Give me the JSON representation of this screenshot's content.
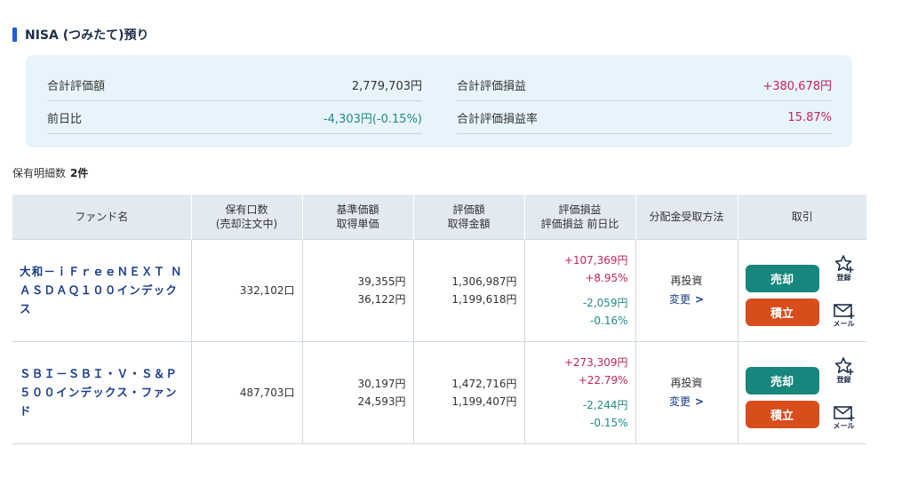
{
  "section": {
    "title": "NISA (つみたて)預り"
  },
  "summary": {
    "total_value_label": "合計評価額",
    "total_value": "2,779,703円",
    "total_pl_label": "合計評価損益",
    "total_pl": "+380,678円",
    "day_change_label": "前日比",
    "day_change": "-4,303円(-0.15%)",
    "total_pl_rate_label": "合計評価損益率",
    "total_pl_rate": "15.87%"
  },
  "holdings": {
    "count_label": "保有明細数",
    "count": "2件",
    "headers": [
      [
        "ファンド名"
      ],
      [
        "保有口数",
        "(売却注文中)"
      ],
      [
        "基準価額",
        "取得単価"
      ],
      [
        "評価額",
        "取得金額"
      ],
      [
        "評価損益",
        "評価損益 前日比"
      ],
      [
        "分配金受取方法"
      ],
      [
        "取引"
      ]
    ],
    "rows": [
      {
        "fund_name": "大和－ｉＦｒｅｅＮＥＸＴ ＮＡＳＤＡＱ１００インデックス",
        "units": "332,102口",
        "nav": "39,355円",
        "unit_cost": "36,122円",
        "value": "1,306,987円",
        "cost": "1,199,618円",
        "pl": "+107,369円",
        "pl_rate": "+8.95%",
        "day_pl": "-2,059円",
        "day_rate": "-0.16%",
        "dist_method": "再投資",
        "change": "変更",
        "sell": "売却",
        "buy": "積立",
        "register": "登録",
        "mail": "メール"
      },
      {
        "fund_name": "ＳＢＩ－ＳＢＩ・Ｖ・Ｓ＆Ｐ５００インデックス・ファンド",
        "units": "487,703口",
        "nav": "30,197円",
        "unit_cost": "24,593円",
        "value": "1,472,716円",
        "cost": "1,199,407円",
        "pl": "+273,309円",
        "pl_rate": "+22.79%",
        "day_pl": "-2,244円",
        "day_rate": "-0.15%",
        "dist_method": "再投資",
        "change": "変更",
        "sell": "売却",
        "buy": "積立",
        "register": "登録",
        "mail": "メール"
      }
    ]
  },
  "colors": {
    "accent": "#1a5fd6",
    "positive": "#c4245a",
    "negative": "#1f8a8a",
    "sell_button": "#17867c",
    "buy_button": "#d84d1c",
    "summary_bg": "#e8f4fb"
  },
  "icons": [
    "star-plus-icon",
    "mail-plus-icon",
    "chevron-right-icon"
  ]
}
